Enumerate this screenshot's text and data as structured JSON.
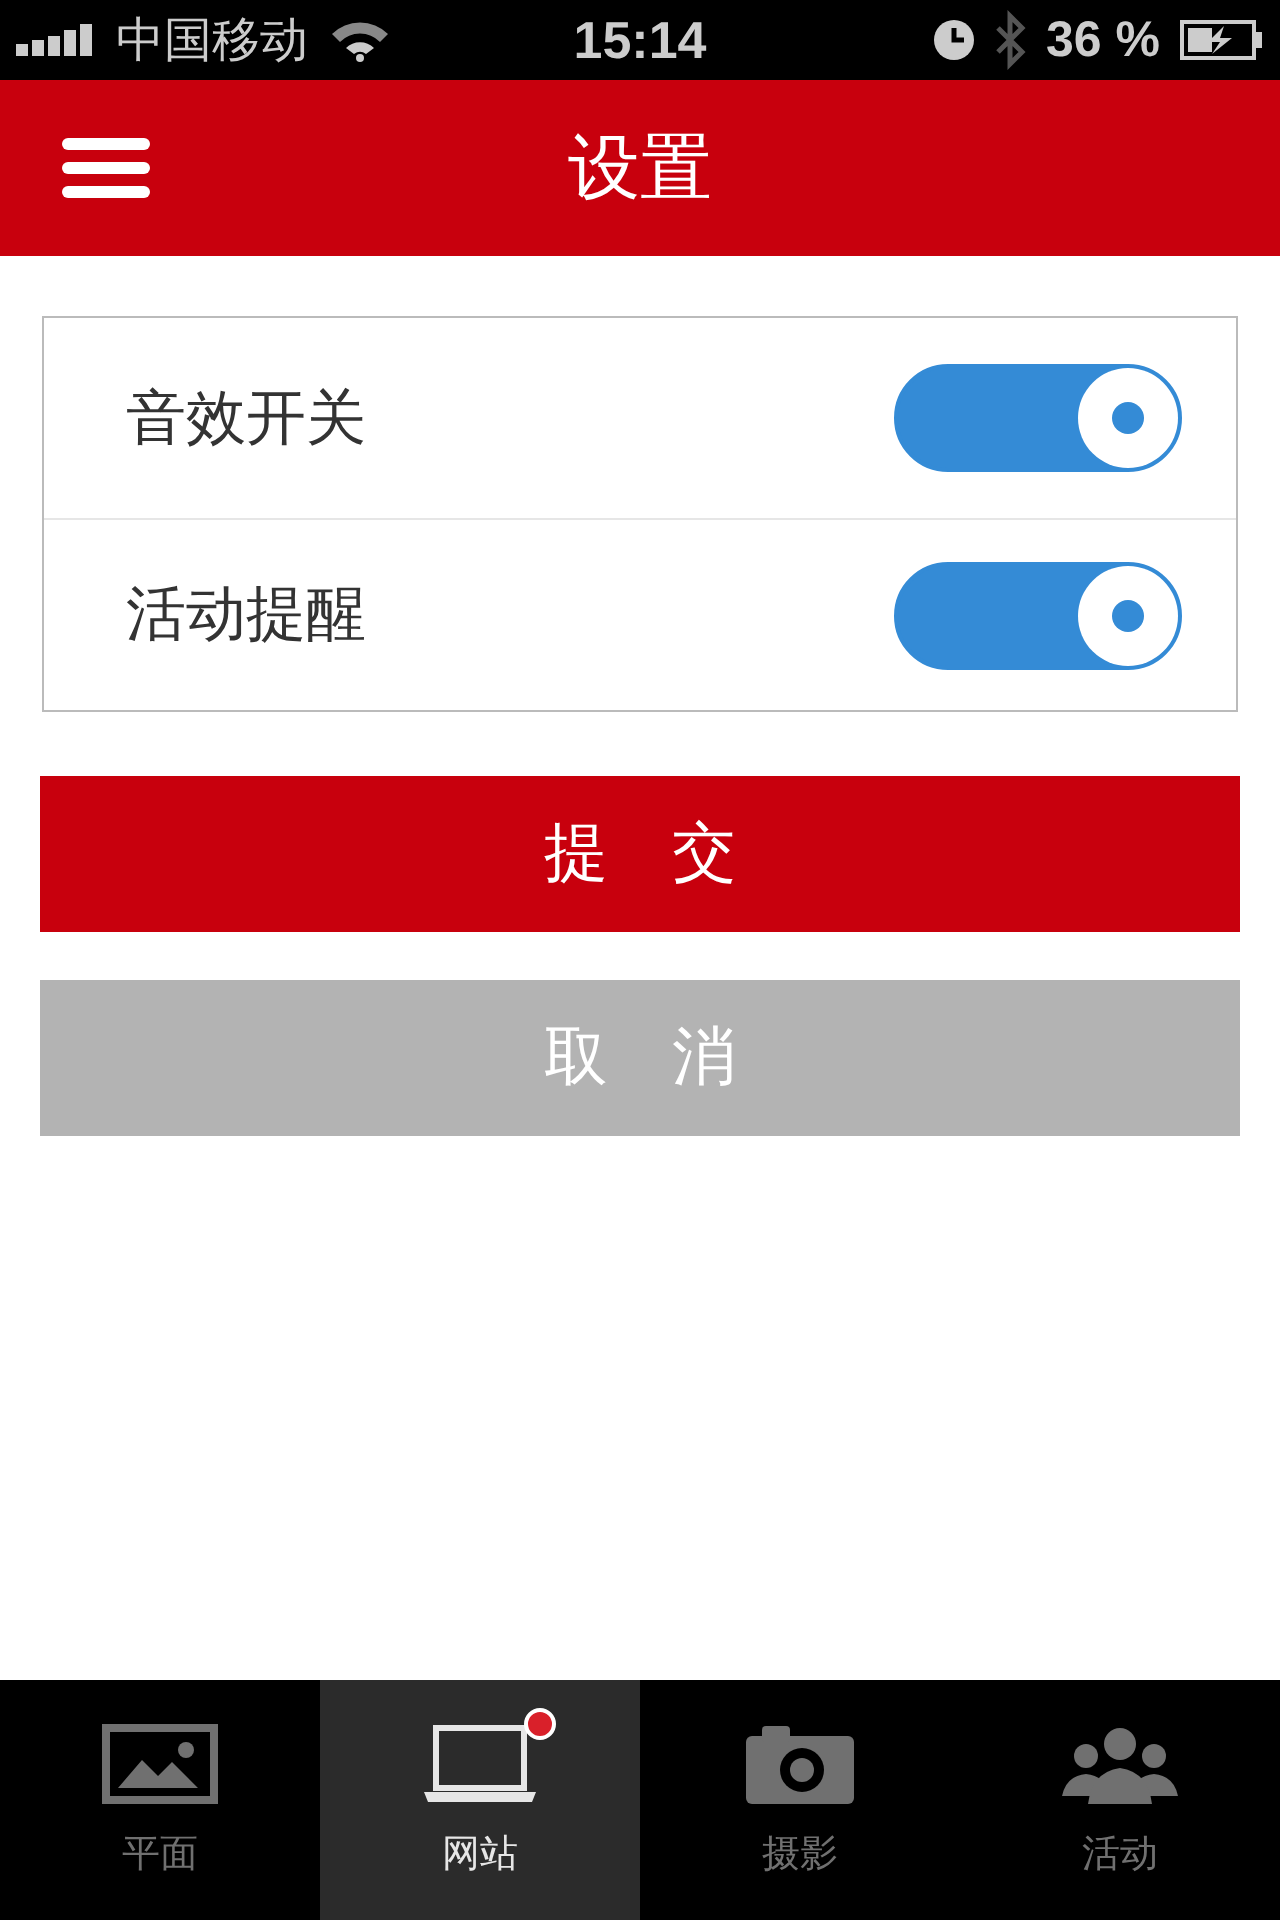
{
  "status_bar": {
    "carrier": "中国移动",
    "time": "15:14",
    "battery": "36 %"
  },
  "header": {
    "title": "设置"
  },
  "settings": [
    {
      "label": "音效开关",
      "on": true
    },
    {
      "label": "活动提醒",
      "on": true
    }
  ],
  "buttons": [
    {
      "label": "提　交",
      "kind": "primary"
    },
    {
      "label": "取　消",
      "kind": "secondary"
    }
  ],
  "tabs": [
    {
      "label": "平面",
      "kind": "picture",
      "selected": false,
      "badge": false
    },
    {
      "label": "网站",
      "kind": "laptop",
      "selected": true,
      "badge": true
    },
    {
      "label": "摄影",
      "kind": "camera",
      "selected": false,
      "badge": false
    },
    {
      "label": "活动",
      "kind": "people",
      "selected": false,
      "badge": false
    }
  ]
}
